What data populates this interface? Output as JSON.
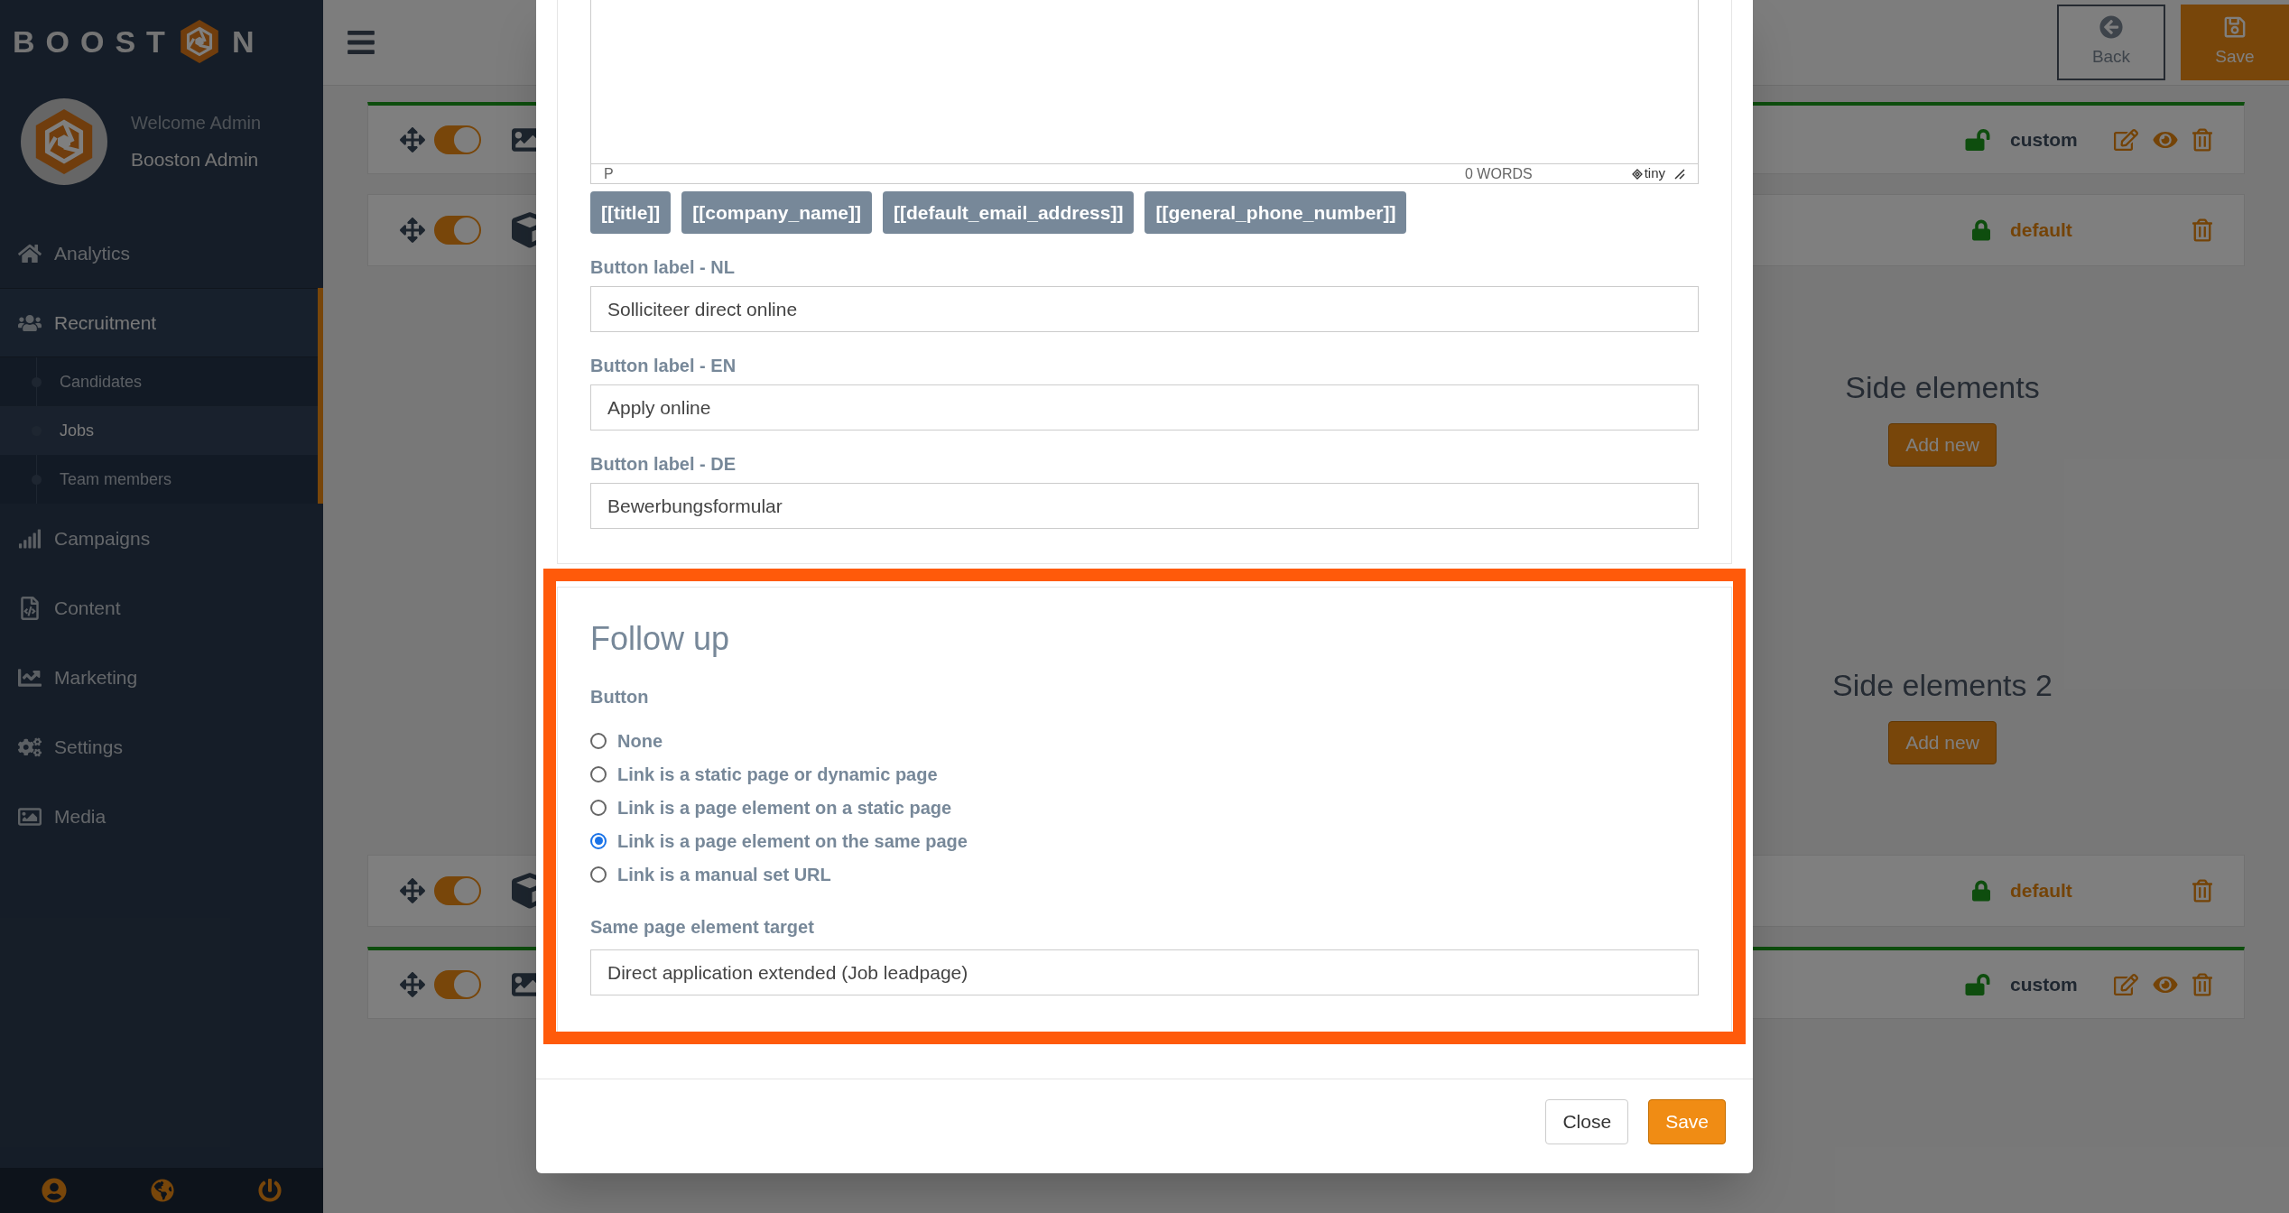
{
  "sidebar": {
    "logo": {
      "before": "BOOST",
      "after": "N"
    },
    "user": {
      "greeting": "Welcome Admin",
      "name": "Booston Admin"
    },
    "items": [
      {
        "label": "Analytics",
        "selected": false
      },
      {
        "label": "Recruitment",
        "selected": true,
        "expanded": true,
        "children": [
          {
            "label": "Candidates",
            "selected": false
          },
          {
            "label": "Jobs",
            "selected": true
          },
          {
            "label": "Team members",
            "selected": false
          }
        ]
      },
      {
        "label": "Campaigns",
        "selected": false
      },
      {
        "label": "Content",
        "selected": false
      },
      {
        "label": "Marketing",
        "selected": false
      },
      {
        "label": "Settings",
        "selected": false
      },
      {
        "label": "Media",
        "selected": false
      }
    ]
  },
  "toolbar": {
    "back": "Back",
    "save": "Save"
  },
  "rows_top": [
    {
      "kind": "custom",
      "label": "custom",
      "on": true,
      "locked": false,
      "highlighted": true
    },
    {
      "kind": "default",
      "label": "default",
      "on": true,
      "locked": true,
      "highlighted": false
    }
  ],
  "side_sections": [
    {
      "title": "Side elements",
      "button": "Add new"
    },
    {
      "title": "Side elements 2",
      "button": "Add new"
    }
  ],
  "rows_bottom": [
    {
      "kind": "default",
      "label": "default",
      "on": true,
      "locked": true,
      "highlighted": false
    },
    {
      "kind": "custom",
      "label": "custom",
      "on": true,
      "locked": false,
      "highlighted": true
    }
  ],
  "modal": {
    "editor": {
      "path": "P",
      "word_count": "0 WORDS",
      "brand": "tiny"
    },
    "tokens": [
      "[[title]]",
      "[[company_name]]",
      "[[default_email_address]]",
      "[[general_phone_number]]"
    ],
    "fields": [
      {
        "label": "Button label - NL",
        "value": "Solliciteer direct online"
      },
      {
        "label": "Button label - EN",
        "value": "Apply online"
      },
      {
        "label": "Button label - DE",
        "value": "Bewerbungsformular"
      }
    ],
    "follow_up": {
      "title": "Follow up",
      "group_label": "Button",
      "options": [
        {
          "label": "None",
          "selected": false
        },
        {
          "label": "Link is a static page or dynamic page",
          "selected": false
        },
        {
          "label": "Link is a page element on a static page",
          "selected": false
        },
        {
          "label": "Link is a page element on the same page",
          "selected": true
        },
        {
          "label": "Link is a manual set URL",
          "selected": false
        }
      ],
      "target": {
        "label": "Same page element target",
        "value": "Direct application extended (Job leadpage)"
      }
    },
    "footer": {
      "close": "Close",
      "save": "Save"
    }
  }
}
